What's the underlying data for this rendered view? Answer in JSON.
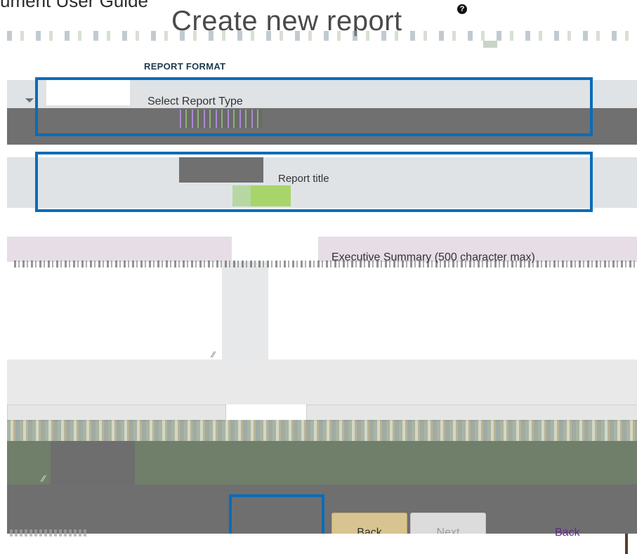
{
  "doc": {
    "running_title": "ument User Guide"
  },
  "page": {
    "heading": "Create new report",
    "help_glyph": "?"
  },
  "report_format": {
    "section_label": "REPORT FORMAT",
    "report_type_label": "Select Report Type",
    "report_title_label": "Report title"
  },
  "text_areas": {
    "summary_label": "Executive Summary (500 character max)"
  },
  "actions": {
    "back_button": "Back",
    "next_button": "Next",
    "back_link": "Back"
  },
  "colors": {
    "highlight": "#0a6cb8",
    "back_button_bg": "#d8c490",
    "link": "#5a2d82"
  }
}
